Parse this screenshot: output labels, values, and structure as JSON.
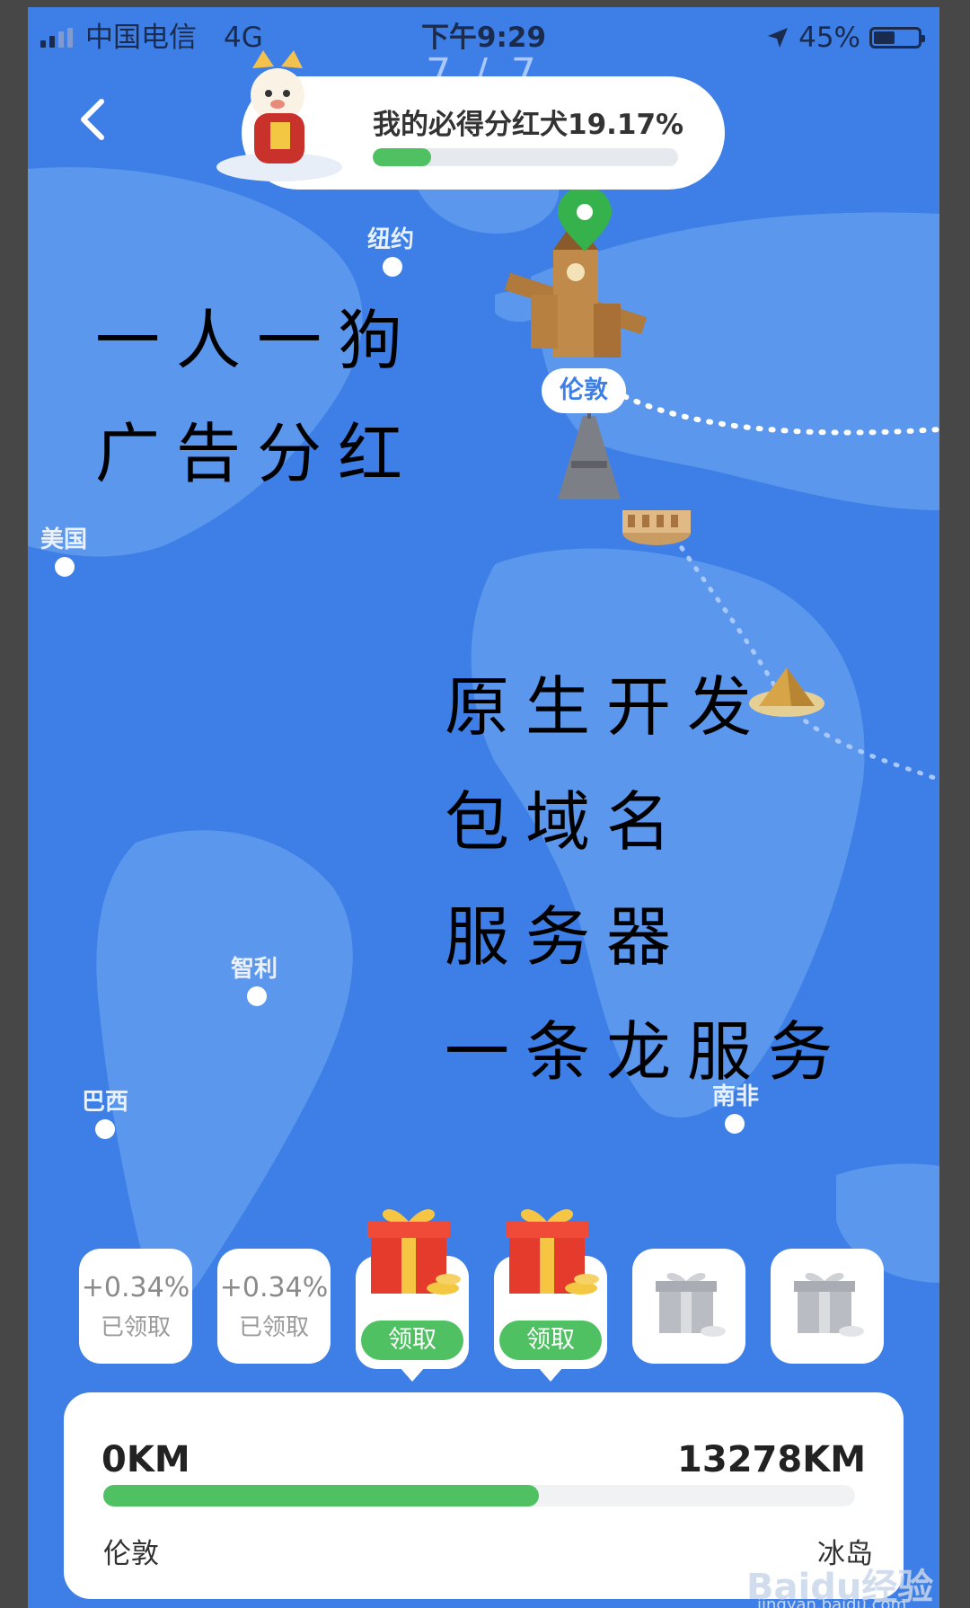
{
  "status_bar": {
    "carrier": "中国电信",
    "network": "4G",
    "time": "下午9:29",
    "battery": "45%"
  },
  "pager": "7 / 7",
  "header": {
    "title": "我的必得分红犬19.17%",
    "progress_percent": 19.17
  },
  "map": {
    "cities": {
      "new_york": "纽约",
      "usa": "美国",
      "chile": "智利",
      "brazil": "巴西",
      "south_africa": "南非"
    },
    "current_city": "伦敦"
  },
  "overlay": {
    "line1": "一人一狗",
    "line2": "广告分红",
    "line3": "原生开发",
    "line4": "包域名",
    "line5": "服务器",
    "line6": "一条龙服务"
  },
  "rewards": [
    {
      "value": "+0.34%",
      "status": "已领取"
    },
    {
      "value": "+0.34%",
      "status": "已领取"
    },
    {
      "button": "领取"
    },
    {
      "button": "领取"
    },
    {
      "icon": "gift-grey-icon"
    },
    {
      "icon": "gift-grey-icon"
    }
  ],
  "route": {
    "start_km": "0KM",
    "end_km": "13278KM",
    "start_place": "伦敦",
    "end_place": "冰岛",
    "progress_fraction": 0.58
  },
  "watermark": {
    "logo": "Baidu经验",
    "url": "jingyan.baidu.com"
  },
  "colors": {
    "map_blue": "#3d7fe6",
    "land_blue": "#5b97ec",
    "accent_green": "#4fc162"
  }
}
